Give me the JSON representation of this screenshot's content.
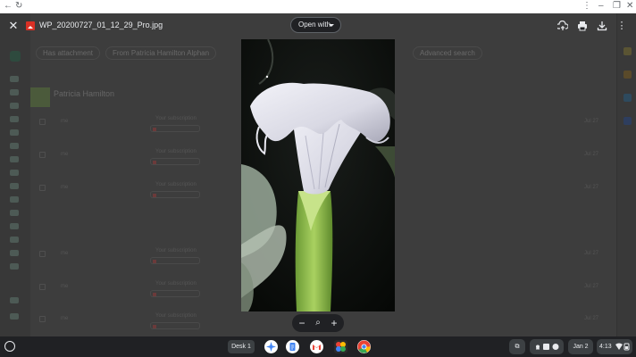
{
  "chrome": {
    "back_icon": "back-arrow-icon",
    "reload_icon": "reload-icon",
    "menu_icon": "kebab-menu-icon",
    "minimize_icon": "minimize-icon",
    "restore_icon": "restore-icon",
    "close_icon": "close-icon"
  },
  "background": {
    "chips": [
      "Has attachment",
      "From Patricia Hamilton Alphan",
      "Advanced search"
    ],
    "sender": "Patricia Hamilton",
    "rows": [
      {
        "name": "me",
        "subject": "Your subscription",
        "attachment": "WP_20200727_0...",
        "date": "Jul 27"
      },
      {
        "name": "me",
        "subject": "Your subscription",
        "attachment": "WP_20200727_0...",
        "date": "Jul 27"
      },
      {
        "name": "me",
        "subject": "Your subscription",
        "attachment": "WP_20200727_0...",
        "date": "Jul 27"
      },
      {
        "name": "me",
        "subject": "Your subscription",
        "attachment": "WP_20200727_0...",
        "date": "Jul 27"
      },
      {
        "name": "me",
        "subject": "Your subscription",
        "attachment": "WP_20200727_0...",
        "date": "Jul 27"
      },
      {
        "name": "me",
        "subject": "Your subscription",
        "attachment": "WP_20200727_0...",
        "date": "Jul 27"
      }
    ]
  },
  "viewer": {
    "file_name": "WP_20200727_01_12_29_Pro.jpg",
    "open_with_label": "Open with",
    "icons": [
      "close-icon",
      "add-to-drive-icon",
      "print-icon",
      "download-icon",
      "more-options-icon"
    ],
    "zoom": {
      "out": "−",
      "reset": "⌕",
      "in": "+"
    }
  },
  "shelf": {
    "desk_label": "Desk 1",
    "date": "Jan 2",
    "time": "4:13",
    "apps": [
      "assistant",
      "google-docs",
      "gmail",
      "photos",
      "chrome"
    ]
  },
  "colors": {
    "overlay": "#202124",
    "accent_red": "#d93025",
    "gmail_red": "#ea4335",
    "flower": "#e8e8ee",
    "stem": "#8fbf4a"
  }
}
